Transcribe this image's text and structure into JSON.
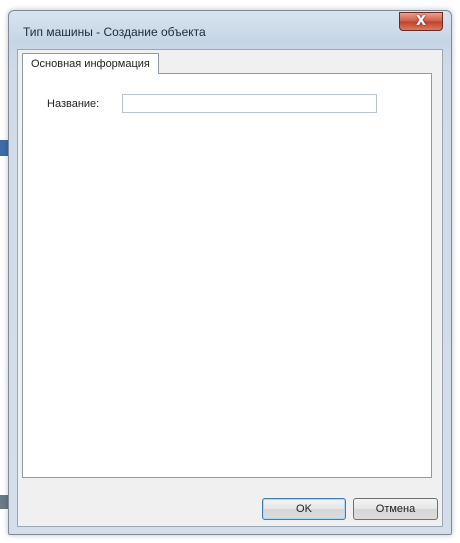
{
  "window": {
    "title": "Тип машины - Создание объекта",
    "close_symbol": "X"
  },
  "tabs": [
    {
      "label": "Основная информация",
      "selected": true
    }
  ],
  "form": {
    "name_label": "Название:",
    "name_value": "",
    "name_placeholder": ""
  },
  "buttons": {
    "ok_label": "OK",
    "cancel_label": "Отмена"
  },
  "icons": {
    "close": "close-icon"
  },
  "colors": {
    "close_button": "#cf5a44",
    "window_frame": "#c6d6e6",
    "default_button_border": "#3c7fb1"
  }
}
